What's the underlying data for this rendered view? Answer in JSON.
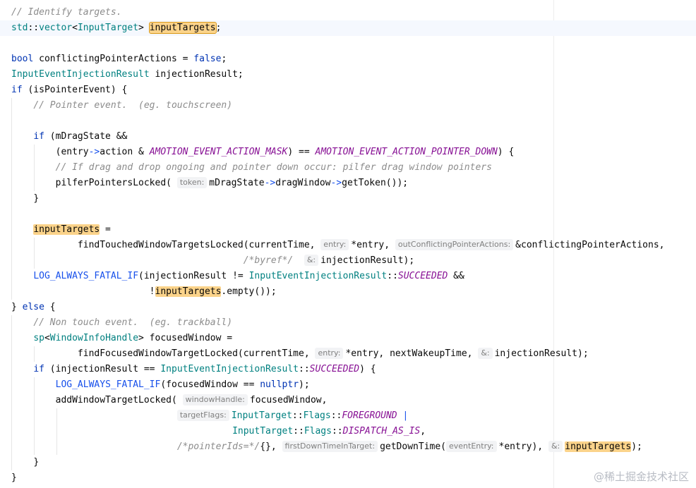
{
  "editor": {
    "language": "C++",
    "watermark": "@稀土掘金技术社区"
  },
  "code": {
    "l1_comment": "// Identify targets.",
    "l2_std": "std",
    "l2_vector": "vector",
    "l2_type": "InputTarget",
    "l2_var": "inputTargets",
    "l4_bool": "bool",
    "l4_rest": " conflictingPointerActions = ",
    "l4_false": "false",
    "l5_type": "InputEventInjectionResult",
    "l5_rest": " injectionResult;",
    "l6_if": "if",
    "l6_rest": " (isPointerEvent) {",
    "l7_comment": "// Pointer event.  (eg. touchscreen)",
    "l9_if": "if",
    "l9_rest": " (mDragState &&",
    "l10_a": "(entry",
    "l10_arrow": "->",
    "l10_b": "action & ",
    "l10_c1": "AMOTION_EVENT_ACTION_MASK",
    "l10_d": ") == ",
    "l10_c2": "AMOTION_EVENT_ACTION_POINTER_DOWN",
    "l10_e": ") {",
    "l11_comment": "// If drag and drop ongoing and pointer down occur: pilfer drag window pointers",
    "l12_fn": "pilferPointersLocked(",
    "l12_hint": "token:",
    "l12_b": "mDragState",
    "l12_arrow1": "->",
    "l12_c": "dragWindow",
    "l12_arrow2": "->",
    "l12_d": "getToken());",
    "l13_brace": "}",
    "l15_var": "inputTargets",
    "l15_eq": " =",
    "l16_fn": "findTouchedWindowTargetsLocked(currentTime, ",
    "l16_hint1": "entry:",
    "l16_b": "*entry, ",
    "l16_hint2": "outConflictingPointerActions:",
    "l16_c": "&conflictingPointerActions,",
    "l17_comment": "/*byref*/",
    "l17_hint": "&:",
    "l17_b": "injectionResult);",
    "l18_macro": "LOG_ALWAYS_FATAL_IF",
    "l18_a": "(injectionResult != ",
    "l18_type": "InputEventInjectionResult",
    "l18_sep": "::",
    "l18_const": "SUCCEEDED",
    "l18_b": " &&",
    "l19_bang": "!",
    "l19_var": "inputTargets",
    "l19_b": ".empty());",
    "l20_brace": "} ",
    "l20_else": "else",
    "l20_b": " {",
    "l21_comment": "// Non touch event.  (eg. trackball)",
    "l22_sp": "sp",
    "l22_type": "WindowInfoHandle",
    "l22_b": "> focusedWindow =",
    "l23_fn": "findFocusedWindowTargetLocked(currentTime, ",
    "l23_hint1": "entry:",
    "l23_b": "*entry, nextWakeupTime, ",
    "l23_hint2": "&:",
    "l23_c": "injectionResult);",
    "l24_if": "if",
    "l24_a": " (injectionResult == ",
    "l24_type": "InputEventInjectionResult",
    "l24_sep": "::",
    "l24_const": "SUCCEEDED",
    "l24_b": ") {",
    "l25_macro": "LOG_ALWAYS_FATAL_IF",
    "l25_a": "(focusedWindow == ",
    "l25_null": "nullptr",
    "l25_b": ");",
    "l26_fn": "addWindowTargetLocked(",
    "l26_hint": "windowHandle:",
    "l26_b": "focusedWindow,",
    "l27_hint": "targetFlags:",
    "l27_type": "InputTarget",
    "l27_sep1": "::",
    "l27_flags": "Flags",
    "l27_sep2": "::",
    "l27_const": "FOREGROUND",
    "l27_pipe": " |",
    "l28_type": "InputTarget",
    "l28_sep1": "::",
    "l28_flags": "Flags",
    "l28_sep2": "::",
    "l28_const": "DISPATCH_AS_IS",
    "l28_b": ",",
    "l29_comment": "/*pointerIds=*/",
    "l29_a": "{}, ",
    "l29_hint1": "firstDownTimeInTarget:",
    "l29_b": "getDownTime(",
    "l29_hint2": "eventEntry:",
    "l29_c": "*entry), ",
    "l29_hint3": "&:",
    "l29_var": "inputTargets",
    "l29_d": ");",
    "l30_brace": "}",
    "l31_brace": "}"
  }
}
